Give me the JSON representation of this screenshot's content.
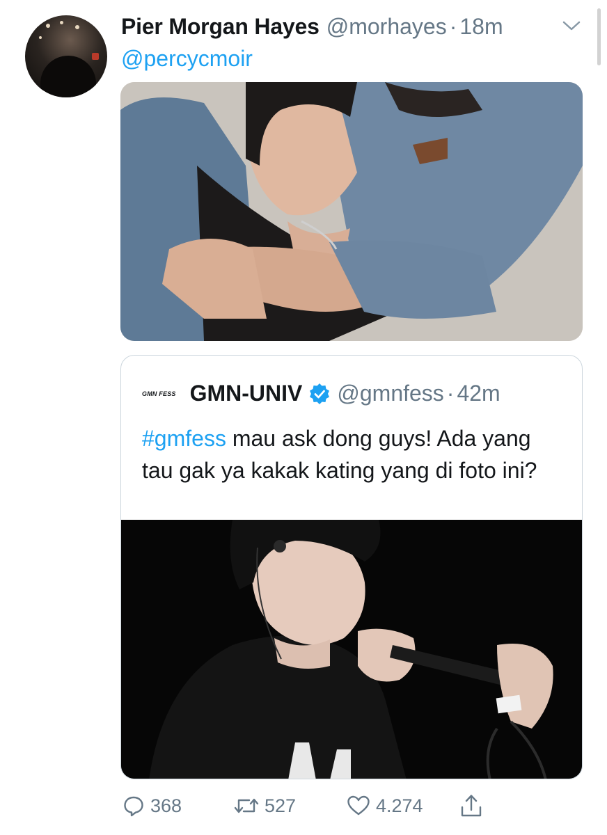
{
  "tweet": {
    "author": {
      "display_name": "Pier Morgan Hayes",
      "handle": "@morhayes",
      "time": "18m"
    },
    "separator": "·",
    "reply_to": "@percycmoir",
    "quoted_tweet": {
      "logo_text": "GMN FESS",
      "display_name": "GMN-UNIV",
      "handle": "@gmnfess",
      "time": "42m",
      "hashtag": "#gmfess",
      "text": " mau ask dong guys! Ada yang tau gak ya kakak kating yang di foto ini?"
    },
    "actions": {
      "replies": "368",
      "retweets": "527",
      "likes": "4.274"
    }
  },
  "icons": {
    "menu": "chevron-down-icon",
    "verified": "verified-badge-icon",
    "reply": "reply-icon",
    "retweet": "retweet-icon",
    "like": "heart-icon",
    "share": "share-icon"
  },
  "colors": {
    "link_blue": "#1da1f2",
    "secondary_text": "#657786",
    "primary_text": "#14171a",
    "border": "#ccd6dd"
  }
}
